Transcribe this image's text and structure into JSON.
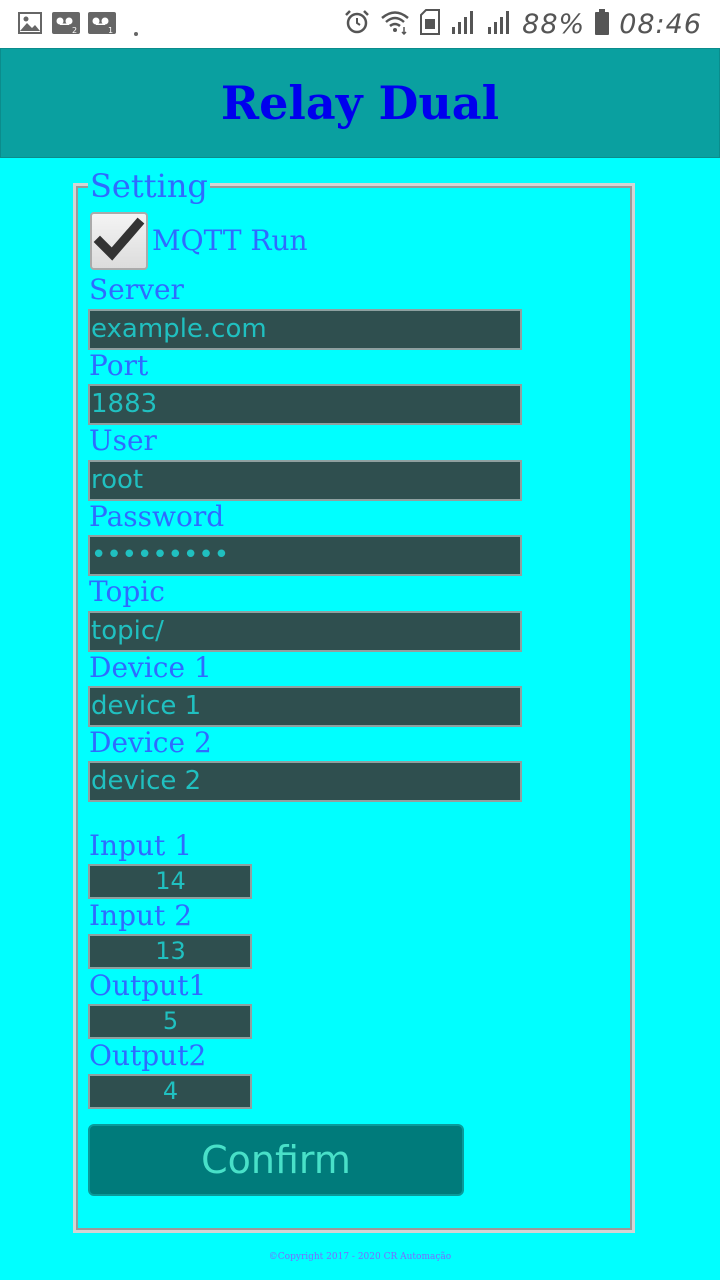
{
  "status_bar": {
    "battery": "88%",
    "time": "08:46",
    "icons": [
      "image-icon",
      "voicemail-2-icon",
      "voicemail-1-icon",
      "dot-icon",
      "alarm-icon",
      "wifi-icon",
      "sim-icon",
      "signal-icon",
      "signal-icon",
      "battery-icon"
    ]
  },
  "header": {
    "title": "Relay Dual"
  },
  "settings": {
    "legend": "Setting",
    "mqtt_run": {
      "label": "MQTT Run",
      "checked": true
    },
    "server": {
      "label": "Server",
      "value": "example.com"
    },
    "port": {
      "label": "Port",
      "value": "1883"
    },
    "user": {
      "label": "User",
      "value": "root"
    },
    "password": {
      "label": "Password",
      "value": "•••••••••"
    },
    "topic": {
      "label": "Topic",
      "value": "topic/"
    },
    "device1": {
      "label": "Device 1",
      "value": "device 1"
    },
    "device2": {
      "label": "Device 2",
      "value": "device 2"
    },
    "input1": {
      "label": "Input 1",
      "value": "14"
    },
    "input2": {
      "label": "Input 2",
      "value": "13"
    },
    "output1": {
      "label": "Output1",
      "value": "5"
    },
    "output2": {
      "label": "Output2",
      "value": "4"
    },
    "confirm_label": "Confirm"
  },
  "footer": {
    "copyright": "©Copyright 2017 - 2020 CR Automação"
  },
  "colors": {
    "background": "#00ffff",
    "header_bg": "#0aa0a0",
    "title": "#0000ee",
    "label": "#2f6bff",
    "input_bg": "#2f4f4f",
    "input_text": "#20c0c0",
    "button_bg": "#007b7b"
  }
}
